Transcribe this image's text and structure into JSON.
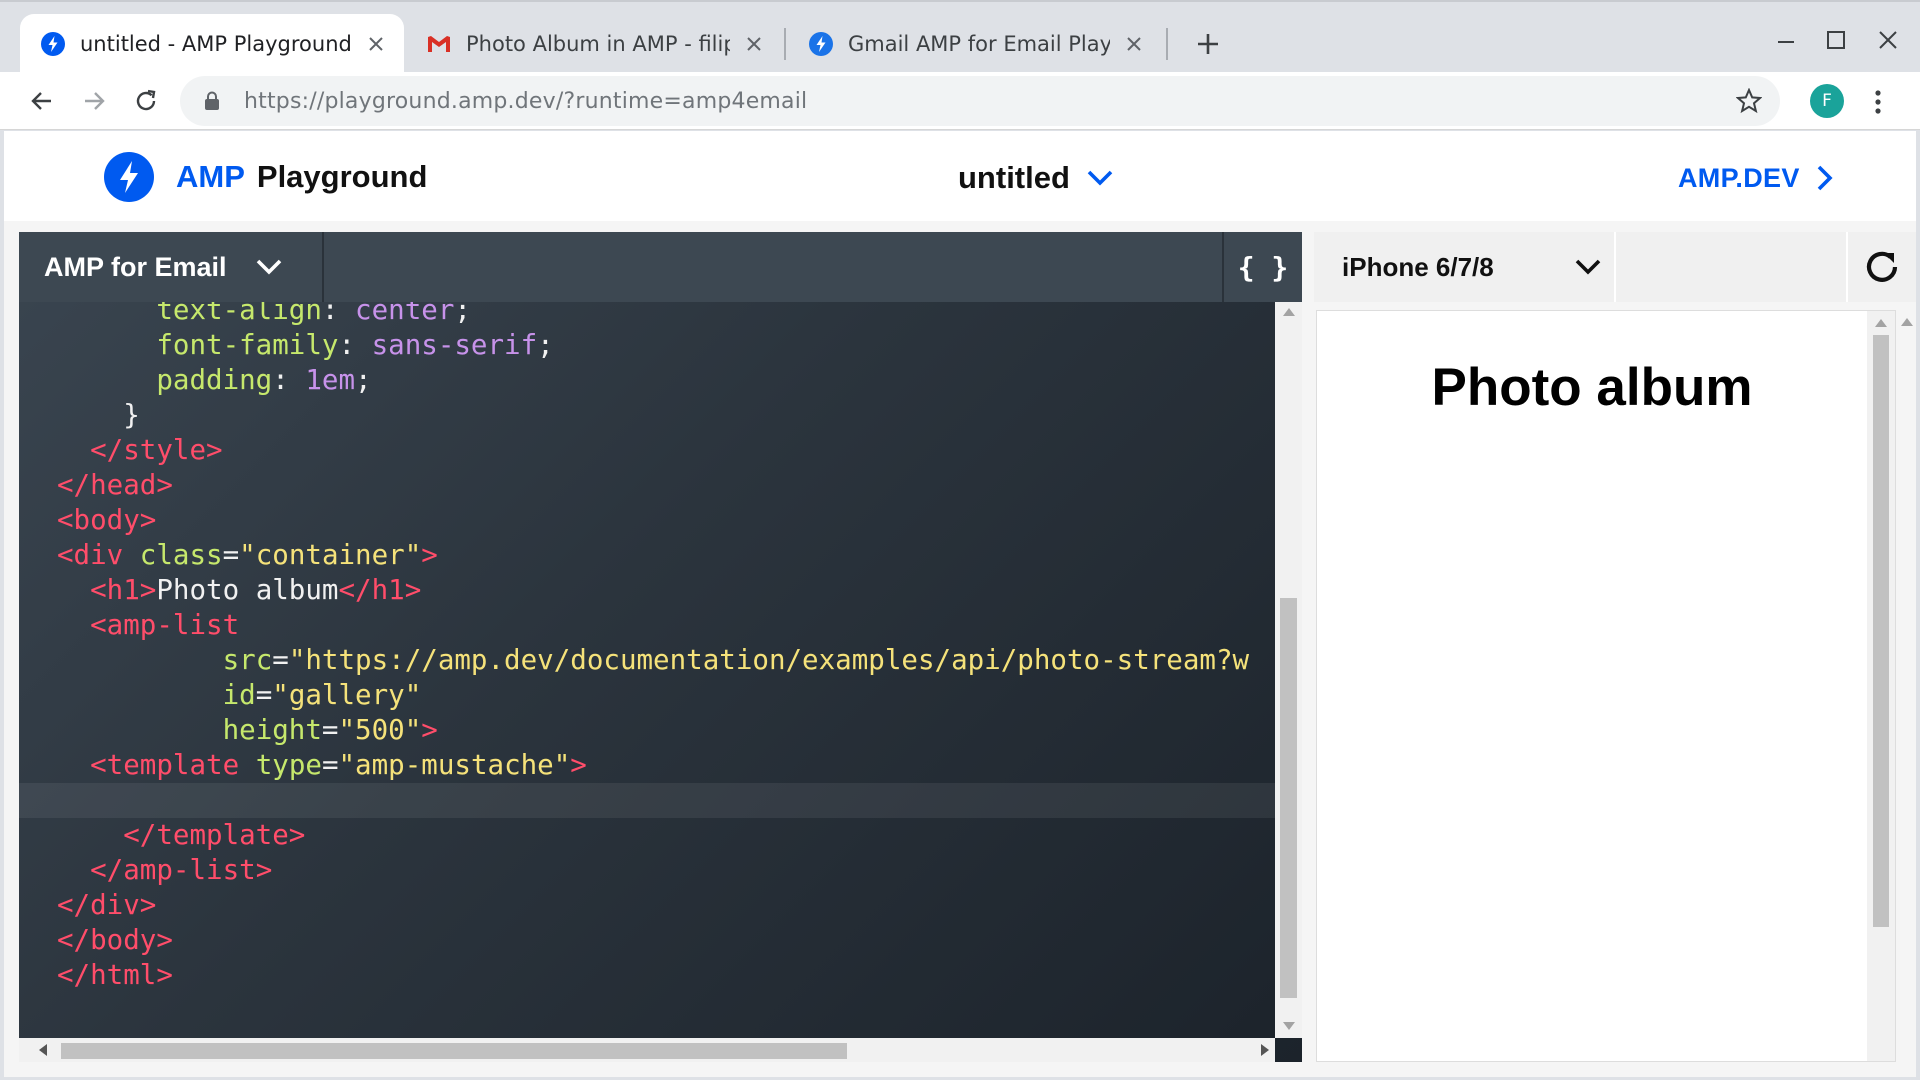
{
  "browser": {
    "tabs": [
      {
        "title": "untitled - AMP Playground",
        "favicon": "amp-bolt-icon",
        "active": true
      },
      {
        "title": "Photo Album in AMP - filip@g",
        "favicon": "gmail-icon",
        "active": false
      },
      {
        "title": "Gmail AMP for Email Playgrou",
        "favicon": "amp-bolt-icon",
        "active": false
      }
    ],
    "url_host": "https://playground.amp.dev",
    "url_path": "/?runtime=amp4email",
    "profile_initial": "F"
  },
  "app": {
    "logo_amp": "AMP",
    "logo_playground": "Playground",
    "doc_title": "untitled",
    "ampdev_link": "AMP.DEV"
  },
  "editor": {
    "format": "AMP for Email",
    "format_button": "{ }",
    "lines": [
      [
        [
          "      ",
          ""
        ],
        [
          "text-align",
          "prop"
        ],
        [
          ": ",
          "txt"
        ],
        [
          "center",
          "kw"
        ],
        [
          ";",
          "txt"
        ]
      ],
      [
        [
          "      ",
          ""
        ],
        [
          "font-family",
          "prop"
        ],
        [
          ": ",
          "txt"
        ],
        [
          "sans-serif",
          "kw"
        ],
        [
          ";",
          "txt"
        ]
      ],
      [
        [
          "      ",
          ""
        ],
        [
          "padding",
          "prop"
        ],
        [
          ": ",
          "txt"
        ],
        [
          "1em",
          "kw"
        ],
        [
          ";",
          "txt"
        ]
      ],
      [
        [
          "    }",
          "txt"
        ]
      ],
      [
        [
          "  ",
          ""
        ],
        [
          "</style>",
          "tag"
        ]
      ],
      [
        [
          "</head>",
          "tag"
        ]
      ],
      [
        [
          "<body>",
          "tag"
        ]
      ],
      [
        [
          "<div ",
          "tag"
        ],
        [
          "class",
          "attr"
        ],
        [
          "=",
          "txt"
        ],
        [
          "\"container\"",
          "str"
        ],
        [
          ">",
          "tag"
        ]
      ],
      [
        [
          "  ",
          ""
        ],
        [
          "<h1>",
          "tag"
        ],
        [
          "Photo album",
          "txt"
        ],
        [
          "</h1>",
          "tag"
        ]
      ],
      [
        [
          "  ",
          ""
        ],
        [
          "<amp-list",
          "tag"
        ]
      ],
      [
        [
          "          ",
          ""
        ],
        [
          "src",
          "attr"
        ],
        [
          "=",
          "txt"
        ],
        [
          "\"https://amp.dev/documentation/examples/api/photo-stream?w",
          "str"
        ]
      ],
      [
        [
          "          ",
          ""
        ],
        [
          "id",
          "attr"
        ],
        [
          "=",
          "txt"
        ],
        [
          "\"gallery\"",
          "str"
        ]
      ],
      [
        [
          "          ",
          ""
        ],
        [
          "height",
          "attr"
        ],
        [
          "=",
          "txt"
        ],
        [
          "\"500\"",
          "str"
        ],
        [
          ">",
          "tag"
        ]
      ],
      [
        [
          "  ",
          ""
        ],
        [
          "<template ",
          "tag"
        ],
        [
          "type",
          "attr"
        ],
        [
          "=",
          "txt"
        ],
        [
          "\"amp-mustache\"",
          "str"
        ],
        [
          ">",
          "tag"
        ]
      ],
      [
        [
          "",
          ""
        ]
      ],
      [
        [
          "    ",
          ""
        ],
        [
          "</template>",
          "tag"
        ]
      ],
      [
        [
          "  ",
          ""
        ],
        [
          "</amp-list>",
          "tag"
        ]
      ],
      [
        [
          "</div>",
          "tag"
        ]
      ],
      [
        [
          "</body>",
          "tag"
        ]
      ],
      [
        [
          "</html>",
          "tag"
        ]
      ]
    ],
    "current_line": 14
  },
  "preview": {
    "device": "iPhone 6/7/8",
    "heading": "Photo album"
  },
  "colors": {
    "amp_blue": "#005af0",
    "tag": "#ff4d6a",
    "attr": "#c6e86c",
    "string": "#f5e27a",
    "keyword": "#c792ea"
  }
}
